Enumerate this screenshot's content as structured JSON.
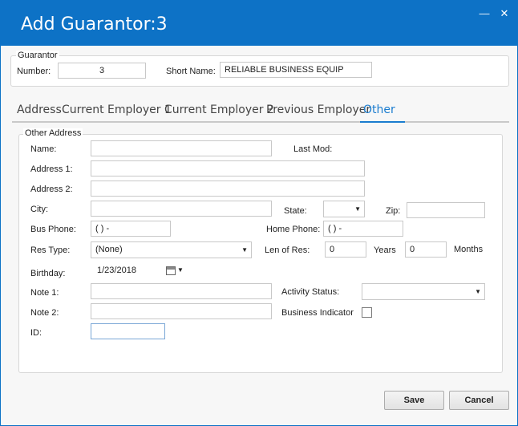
{
  "window": {
    "title": "Add Guarantor:3",
    "minimize_glyph": "—",
    "close_glyph": "✕"
  },
  "guarantor": {
    "group_label": "Guarantor",
    "number_label": "Number:",
    "number_value": "3",
    "short_name_label": "Short Name:",
    "short_name_value": "RELIABLE BUSINESS EQUIP"
  },
  "tabs": [
    {
      "label": "Address"
    },
    {
      "label": "Current Employer 1"
    },
    {
      "label": "Current Employer 2"
    },
    {
      "label": "Previous Employer"
    },
    {
      "label": "Other"
    }
  ],
  "other_address": {
    "group_label": "Other Address",
    "name_label": "Name:",
    "name_value": "",
    "last_mod_label": "Last Mod:",
    "address1_label": "Address 1:",
    "address1_value": "",
    "address2_label": "Address 2:",
    "address2_value": "",
    "city_label": "City:",
    "city_value": "",
    "state_label": "State:",
    "state_value": "",
    "zip_label": "Zip:",
    "zip_value": "",
    "bus_phone_label": "Bus Phone:",
    "bus_phone_value": "(  )   -",
    "home_phone_label": "Home Phone:",
    "home_phone_value": "(  )   -",
    "res_type_label": "Res Type:",
    "res_type_value": "(None)",
    "len_of_res_label": "Len of Res:",
    "years_value": "0",
    "years_label": "Years",
    "months_value": "0",
    "months_label": "Months",
    "birthday_label": "Birthday:",
    "birthday_value": "1/23/2018",
    "note1_label": "Note 1:",
    "note1_value": "",
    "activity_status_label": "Activity Status:",
    "activity_status_value": "",
    "note2_label": "Note 2:",
    "note2_value": "",
    "business_indicator_label": "Business Indicator",
    "business_indicator_checked": false,
    "id_label": "ID:",
    "id_value": ""
  },
  "actions": {
    "save_label": "Save",
    "cancel_label": "Cancel"
  },
  "icons": {
    "dropdown": "chevron-down-icon",
    "calendar": "calendar-icon",
    "minimize": "minimize-icon",
    "close": "close-icon"
  },
  "colors": {
    "titlebar": "#0d72c6",
    "active_tab": "#1a7ccf"
  }
}
